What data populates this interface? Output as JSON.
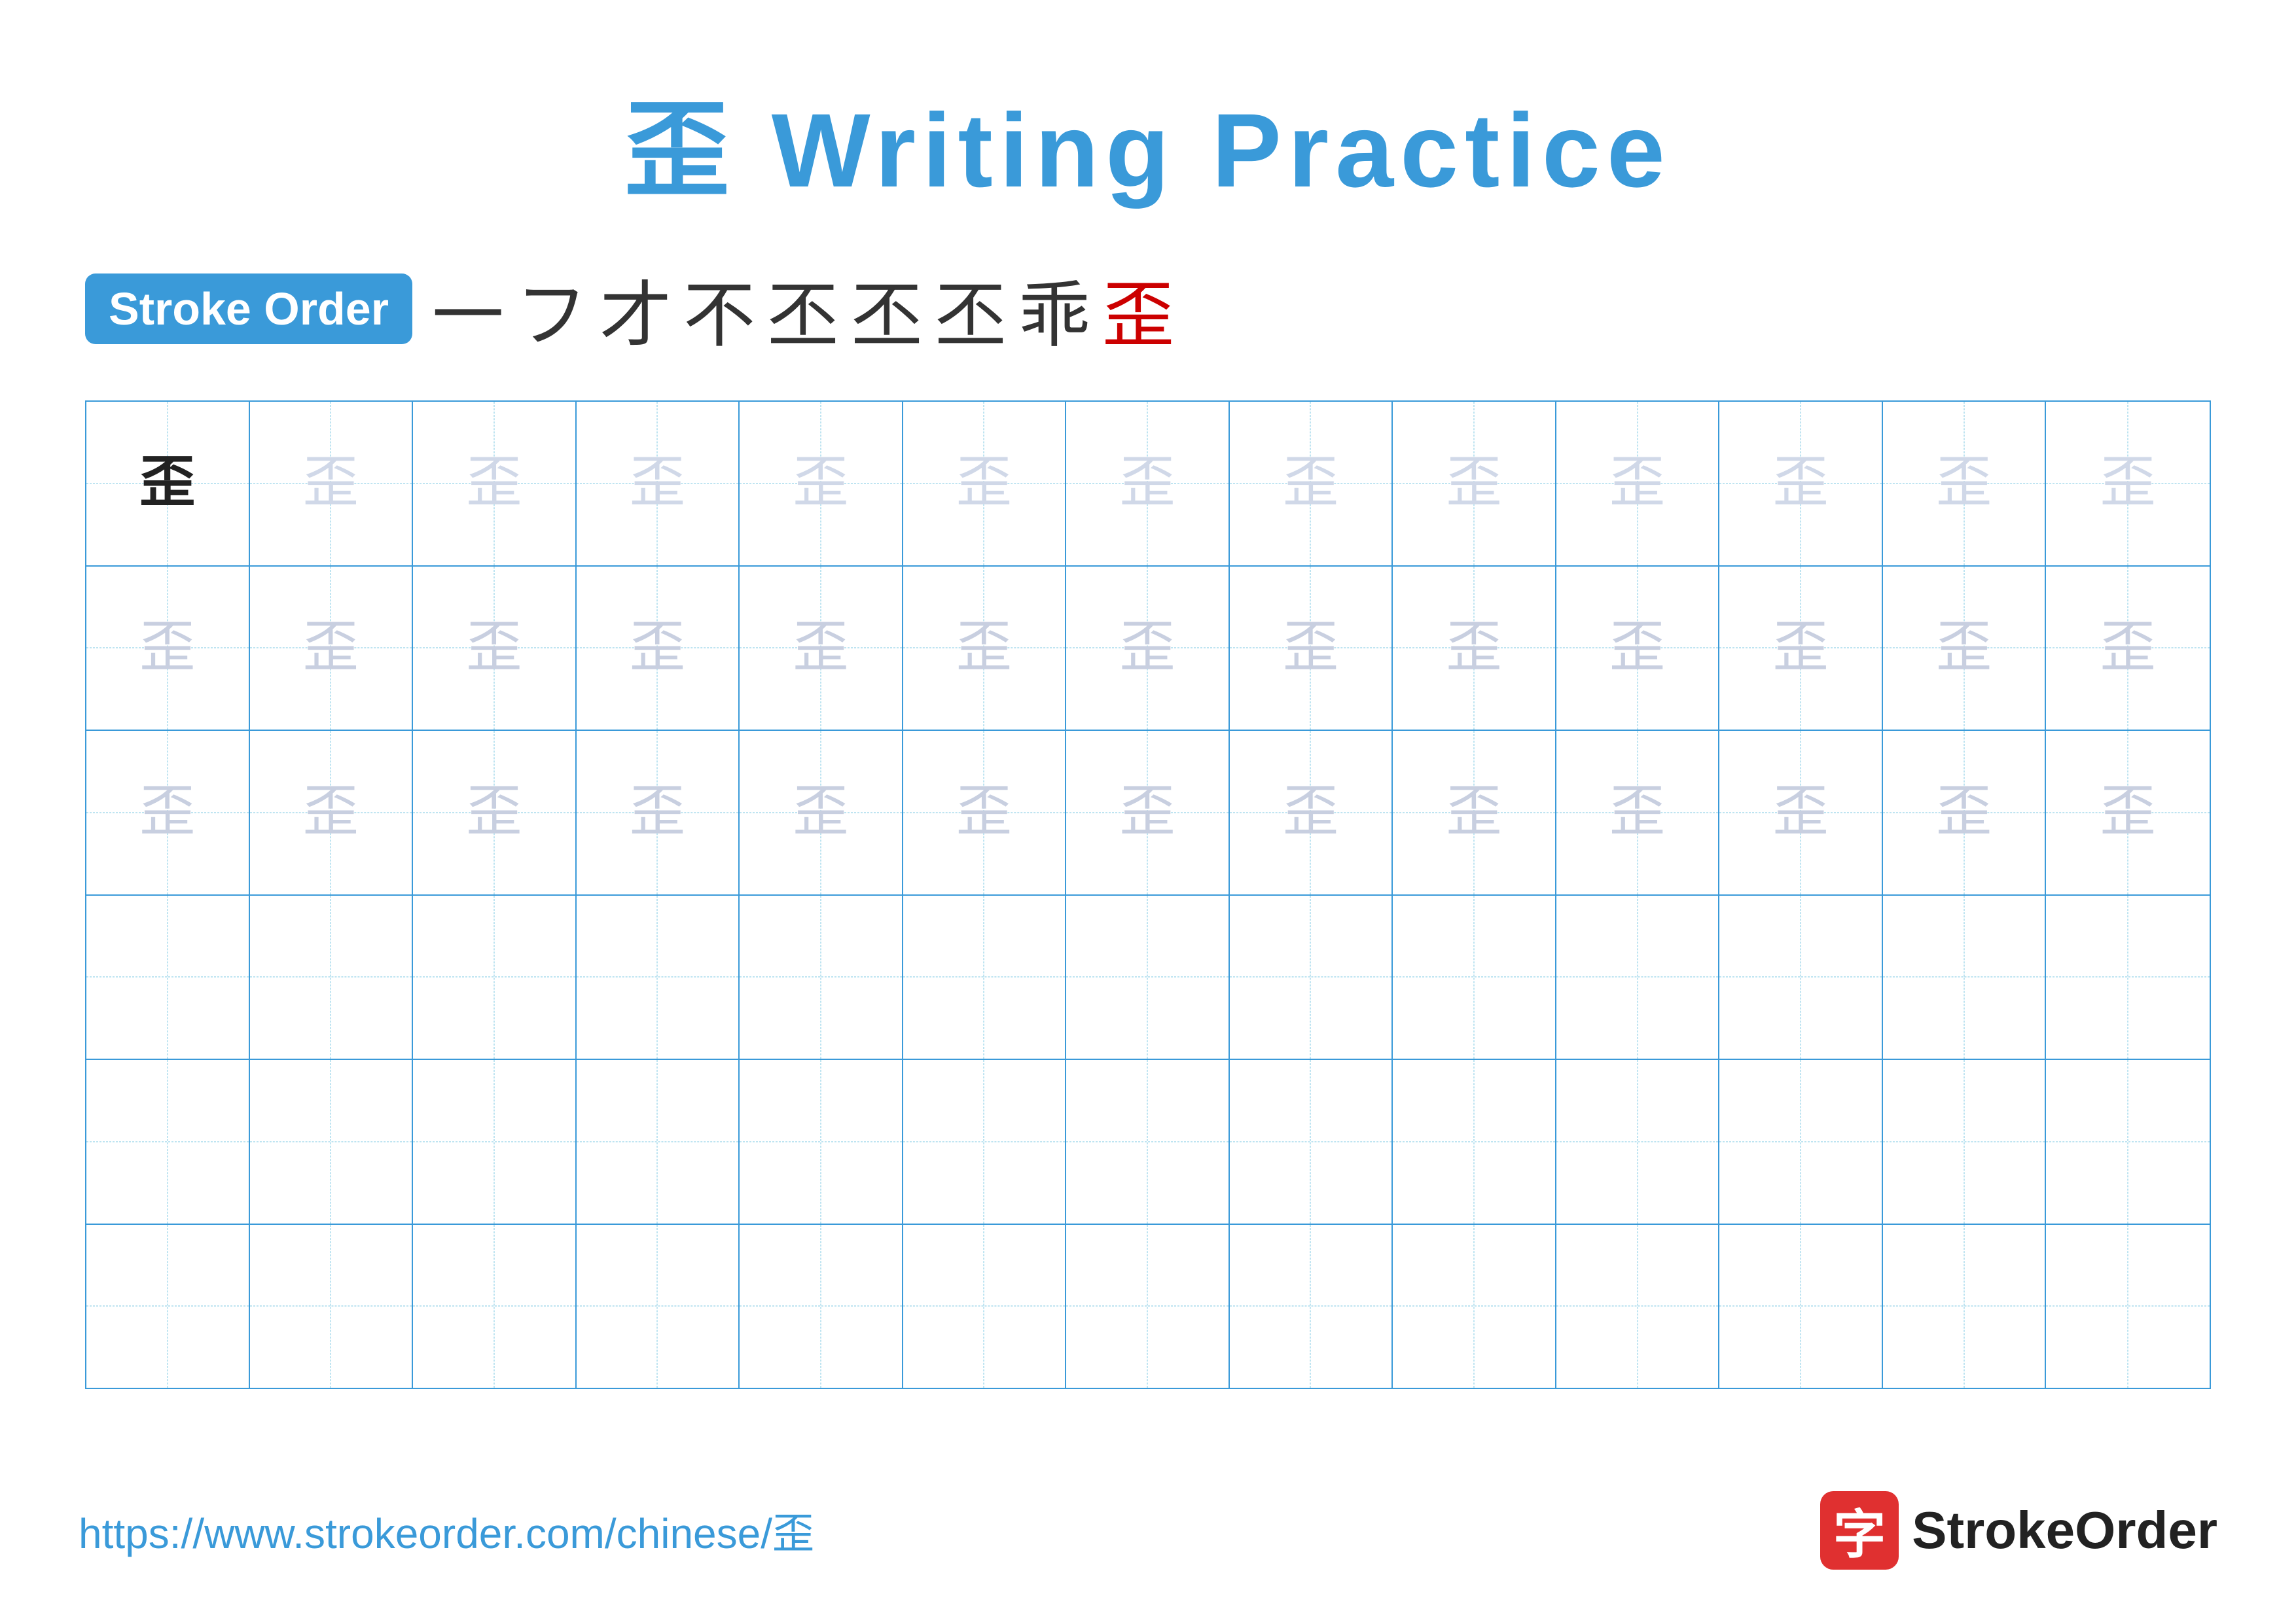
{
  "title": {
    "char": "歪",
    "suffix": " Writing Practice"
  },
  "strokeOrder": {
    "badge": "Stroke Order",
    "strokes": [
      "一",
      "フ",
      "才",
      "不",
      "丕",
      "丕",
      "丕",
      "乖",
      "歪"
    ],
    "lastStrokeRed": true
  },
  "grid": {
    "rows": 6,
    "cols": 13,
    "char": "歪",
    "filledRows": [
      {
        "cells": [
          {
            "type": "dark"
          },
          {
            "type": "light"
          },
          {
            "type": "light"
          },
          {
            "type": "light"
          },
          {
            "type": "light"
          },
          {
            "type": "light"
          },
          {
            "type": "light"
          },
          {
            "type": "light"
          },
          {
            "type": "light"
          },
          {
            "type": "light"
          },
          {
            "type": "light"
          },
          {
            "type": "light"
          },
          {
            "type": "light"
          }
        ]
      },
      {
        "cells": [
          {
            "type": "faded"
          },
          {
            "type": "faded"
          },
          {
            "type": "faded"
          },
          {
            "type": "faded"
          },
          {
            "type": "faded"
          },
          {
            "type": "faded"
          },
          {
            "type": "faded"
          },
          {
            "type": "faded"
          },
          {
            "type": "faded"
          },
          {
            "type": "faded"
          },
          {
            "type": "faded"
          },
          {
            "type": "faded"
          },
          {
            "type": "faded"
          }
        ]
      },
      {
        "cells": [
          {
            "type": "faded"
          },
          {
            "type": "faded"
          },
          {
            "type": "faded"
          },
          {
            "type": "faded"
          },
          {
            "type": "faded"
          },
          {
            "type": "faded"
          },
          {
            "type": "faded"
          },
          {
            "type": "faded"
          },
          {
            "type": "faded"
          },
          {
            "type": "faded"
          },
          {
            "type": "faded"
          },
          {
            "type": "faded"
          },
          {
            "type": "faded"
          }
        ]
      },
      {
        "cells": [
          {
            "type": "empty"
          },
          {
            "type": "empty"
          },
          {
            "type": "empty"
          },
          {
            "type": "empty"
          },
          {
            "type": "empty"
          },
          {
            "type": "empty"
          },
          {
            "type": "empty"
          },
          {
            "type": "empty"
          },
          {
            "type": "empty"
          },
          {
            "type": "empty"
          },
          {
            "type": "empty"
          },
          {
            "type": "empty"
          },
          {
            "type": "empty"
          }
        ]
      },
      {
        "cells": [
          {
            "type": "empty"
          },
          {
            "type": "empty"
          },
          {
            "type": "empty"
          },
          {
            "type": "empty"
          },
          {
            "type": "empty"
          },
          {
            "type": "empty"
          },
          {
            "type": "empty"
          },
          {
            "type": "empty"
          },
          {
            "type": "empty"
          },
          {
            "type": "empty"
          },
          {
            "type": "empty"
          },
          {
            "type": "empty"
          },
          {
            "type": "empty"
          }
        ]
      },
      {
        "cells": [
          {
            "type": "empty"
          },
          {
            "type": "empty"
          },
          {
            "type": "empty"
          },
          {
            "type": "empty"
          },
          {
            "type": "empty"
          },
          {
            "type": "empty"
          },
          {
            "type": "empty"
          },
          {
            "type": "empty"
          },
          {
            "type": "empty"
          },
          {
            "type": "empty"
          },
          {
            "type": "empty"
          },
          {
            "type": "empty"
          },
          {
            "type": "empty"
          }
        ]
      }
    ]
  },
  "footer": {
    "url": "https://www.strokeorder.com/chinese/歪",
    "logoChar": "字",
    "logoText": "StrokeOrder"
  }
}
